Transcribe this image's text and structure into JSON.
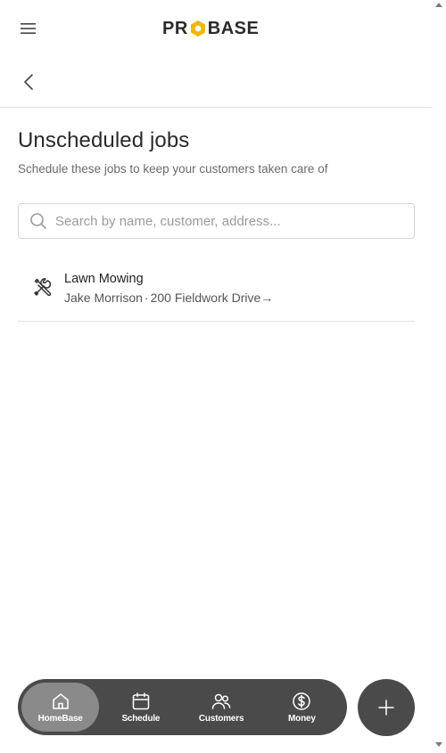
{
  "header": {
    "logo_text": [
      "PR",
      "BASE"
    ],
    "menu_icon": "hamburger-icon",
    "back_icon": "chevron-left-icon"
  },
  "page": {
    "title": "Unscheduled jobs",
    "subtitle": "Schedule these jobs to keep your customers taken care of"
  },
  "search": {
    "placeholder": "Search by name, customer, address...",
    "value": ""
  },
  "jobs": [
    {
      "icon": "tools-icon",
      "title": "Lawn Mowing",
      "customer": "Jake Morrison",
      "separator": "·",
      "address": "200 Fieldwork Drive",
      "arrow": "→"
    }
  ],
  "nav": {
    "items": [
      {
        "label": "HomeBase",
        "icon": "home-icon",
        "active": true
      },
      {
        "label": "Schedule",
        "icon": "calendar-icon",
        "active": false
      },
      {
        "label": "Customers",
        "icon": "users-icon",
        "active": false
      },
      {
        "label": "Money",
        "icon": "dollar-icon",
        "active": false
      }
    ],
    "fab_icon": "plus-icon"
  },
  "colors": {
    "brand_accent": "#f2b705",
    "nav_background": "#4a4a4a",
    "nav_active": "#8a8a8a"
  }
}
